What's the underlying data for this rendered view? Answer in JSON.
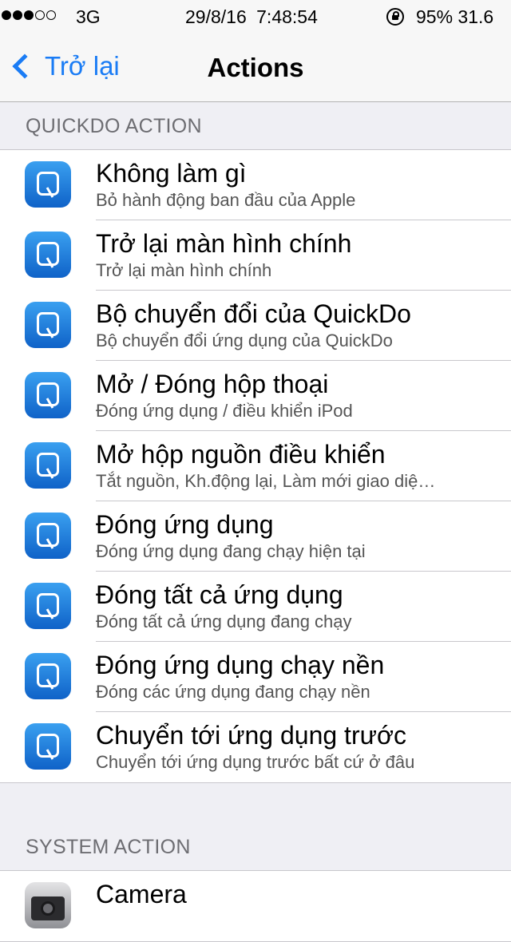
{
  "status_bar": {
    "carrier": "3G",
    "date": "29/8/16",
    "time": "7:48:54",
    "battery": "95% 31.6",
    "signal_bars": [
      true,
      true,
      true,
      false,
      false
    ]
  },
  "nav": {
    "back_label": "Trở lại",
    "title": "Actions"
  },
  "quickdo_section": {
    "header": "QUICKDO ACTION",
    "items": [
      {
        "title": "Không làm gì",
        "subtitle": "Bỏ hành động ban đầu của Apple"
      },
      {
        "title": "Trở lại màn hình chính",
        "subtitle": "Trở lại màn hình chính"
      },
      {
        "title": "Bộ chuyển đổi của QuickDo",
        "subtitle": "Bộ chuyển đổi ứng dụng của QuickDo"
      },
      {
        "title": "Mở / Đóng hộp thoại",
        "subtitle": "Đóng ứng dụng / điều khiển iPod"
      },
      {
        "title": "Mở hộp nguồn điều khiển",
        "subtitle": "Tắt nguồn, Kh.động lại, Làm mới giao diệ…"
      },
      {
        "title": "Đóng ứng dụng",
        "subtitle": "Đóng ứng dụng đang chạy hiện tại"
      },
      {
        "title": "Đóng tất cả ứng dụng",
        "subtitle": "Đóng tất cả ứng dụng đang chạy"
      },
      {
        "title": "Đóng ứng dụng chạy nền",
        "subtitle": "Đóng các ứng dụng đang chạy nền"
      },
      {
        "title": "Chuyển tới ứng dụng trước",
        "subtitle": "Chuyển tới ứng dụng trước bất cứ ở đâu"
      }
    ]
  },
  "system_section": {
    "header": "SYSTEM ACTION",
    "items": [
      {
        "title": "Camera"
      }
    ]
  },
  "colors": {
    "accent": "#1a7cf5",
    "background": "#efeff4",
    "icon_blue": "#0f62c8"
  },
  "icons": {
    "quickdo": "quickdo-app-icon",
    "camera": "camera-app-icon",
    "back": "chevron-left-icon",
    "orientation_lock": "rotation-lock-icon"
  }
}
